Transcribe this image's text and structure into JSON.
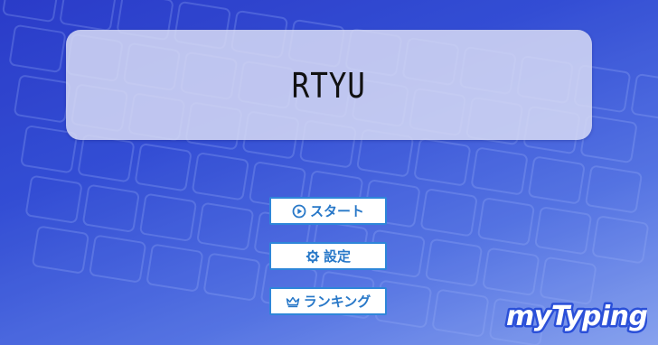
{
  "title": "RTYU",
  "menu": {
    "start_label": "スタート",
    "start_icon": "play-circle-icon",
    "settings_label": "設定",
    "settings_icon": "gear-icon",
    "ranking_label": "ランキング",
    "ranking_icon": "crown-icon"
  },
  "logo": {
    "text": "myTyping"
  },
  "colors": {
    "button_text": "#2878c8",
    "button_border": "#2e86d9",
    "background_top": "#2b3cc9",
    "background_bottom": "#93aef3"
  }
}
